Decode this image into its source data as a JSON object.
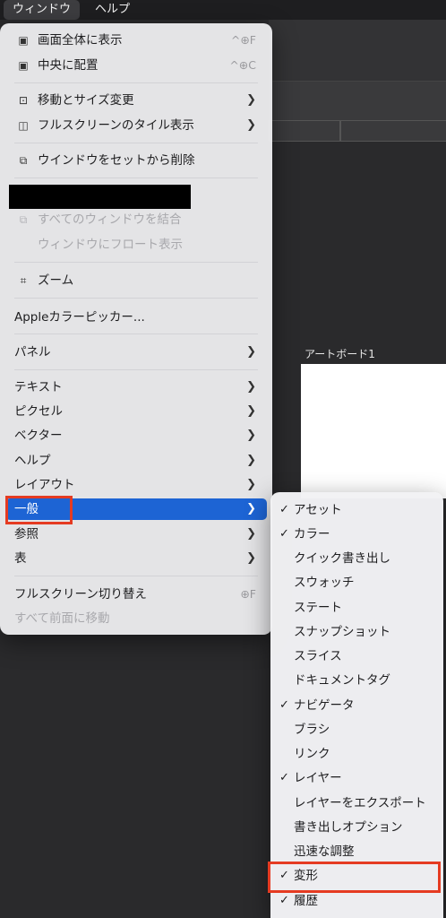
{
  "menubar": {
    "window": "ウィンドウ",
    "help": "ヘルプ"
  },
  "artboard": {
    "label": "アートボード1"
  },
  "menu": {
    "fullscreen_show": {
      "label": "画面全体に表示",
      "shortcut": "^⊕F"
    },
    "center": {
      "label": "中央に配置",
      "shortcut": "^⊕C"
    },
    "move_resize": {
      "label": "移動とサイズ変更"
    },
    "fullscreen_tile": {
      "label": "フルスクリーンのタイル表示"
    },
    "remove_from_set": {
      "label": "ウインドウをセットから削除"
    },
    "merge_all": {
      "label": "すべてのウィンドウを結合"
    },
    "float": {
      "label": "ウィンドウにフロート表示"
    },
    "zoom": {
      "label": "ズーム"
    },
    "color_picker": {
      "label": "Appleカラーピッカー..."
    },
    "panel": {
      "label": "パネル"
    },
    "text": {
      "label": "テキスト"
    },
    "pixel": {
      "label": "ピクセル"
    },
    "vector": {
      "label": "ベクター"
    },
    "help": {
      "label": "ヘルプ"
    },
    "layout": {
      "label": "レイアウト"
    },
    "general": {
      "label": "一般"
    },
    "reference": {
      "label": "参照"
    },
    "table": {
      "label": "表"
    },
    "toggle_fullscreen": {
      "label": "フルスクリーン切り替え",
      "shortcut": "⊕F"
    },
    "bring_all_front": {
      "label": "すべて前面に移動"
    }
  },
  "submenu": {
    "items": [
      {
        "label": "アセット",
        "checked": "✓"
      },
      {
        "label": "カラー",
        "checked": "✓"
      },
      {
        "label": "クイック書き出し",
        "checked": ""
      },
      {
        "label": "スウォッチ",
        "checked": ""
      },
      {
        "label": "ステート",
        "checked": ""
      },
      {
        "label": "スナップショット",
        "checked": ""
      },
      {
        "label": "スライス",
        "checked": ""
      },
      {
        "label": "ドキュメントタグ",
        "checked": ""
      },
      {
        "label": "ナビゲータ",
        "checked": "✓"
      },
      {
        "label": "ブラシ",
        "checked": ""
      },
      {
        "label": "リンク",
        "checked": ""
      },
      {
        "label": "レイヤー",
        "checked": "✓"
      },
      {
        "label": "レイヤーをエクスポート",
        "checked": ""
      },
      {
        "label": "書き出しオプション",
        "checked": ""
      },
      {
        "label": "迅速な調整",
        "checked": ""
      },
      {
        "label": "変形",
        "checked": "✓"
      },
      {
        "label": "履歴",
        "checked": "✓"
      }
    ]
  }
}
